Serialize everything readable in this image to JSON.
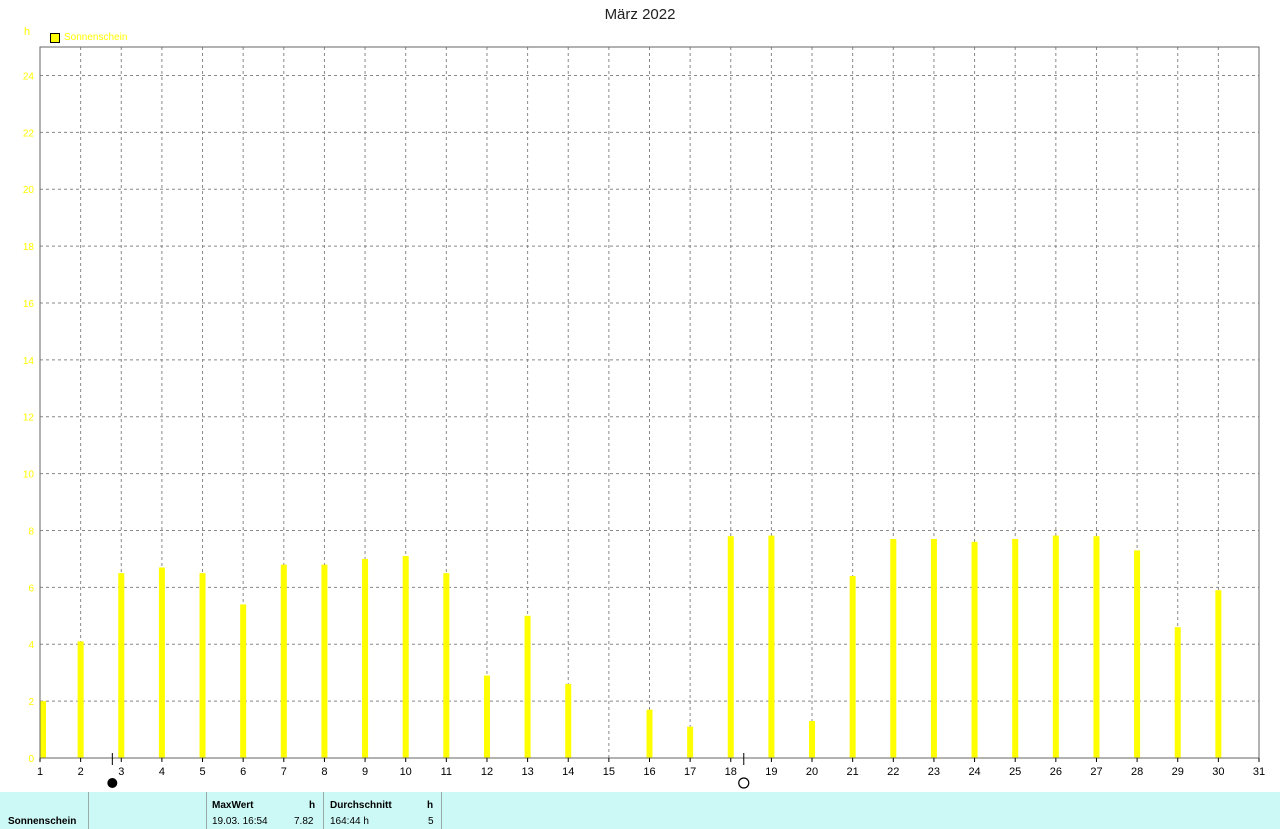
{
  "chart_data": {
    "type": "bar",
    "title": "März 2022",
    "ylabel": "h",
    "ylim": [
      0,
      25
    ],
    "yticks": [
      0,
      2,
      4,
      6,
      8,
      10,
      12,
      14,
      16,
      18,
      20,
      22,
      24
    ],
    "xlim": [
      1,
      31
    ],
    "xticks": [
      "1",
      "2",
      "3",
      "4",
      "5",
      "6",
      "7",
      "8",
      "9",
      "10",
      "11",
      "12",
      "13",
      "14",
      "15",
      "16",
      "17",
      "18",
      "19",
      "20",
      "21",
      "22",
      "23",
      "24",
      "25",
      "26",
      "27",
      "28",
      "29",
      "30",
      "31"
    ],
    "grid": true,
    "legend_position": "top-left",
    "series": [
      {
        "name": "Sonnenschein",
        "color": "#ffff00",
        "x": [
          1,
          2,
          3,
          4,
          5,
          6,
          7,
          8,
          9,
          10,
          11,
          12,
          13,
          14,
          15,
          16,
          17,
          18,
          19,
          20,
          21,
          22,
          23,
          24,
          25,
          26,
          27,
          28,
          29,
          30
        ],
        "values": [
          2.0,
          4.1,
          6.5,
          6.7,
          6.5,
          5.4,
          6.8,
          6.8,
          7.0,
          7.1,
          6.5,
          2.9,
          5.0,
          2.6,
          0.0,
          1.7,
          1.1,
          7.8,
          7.82,
          1.3,
          6.4,
          7.7,
          7.7,
          7.6,
          7.7,
          7.82,
          7.8,
          7.3,
          4.6,
          5.9
        ]
      }
    ],
    "moon_phases": [
      {
        "x": 2.78,
        "icon": "new-moon-icon"
      },
      {
        "x": 18.32,
        "icon": "full-moon-icon"
      }
    ]
  },
  "footer": {
    "series_label": "Sonnenschein",
    "max_header": "MaxWert",
    "max_unit": "h",
    "max_date": "19.03.  16:54",
    "max_value": "7.82",
    "avg_header": "Durchschnitt",
    "avg_unit": "h",
    "avg_value": "164:44 h",
    "avg_count": "5"
  }
}
